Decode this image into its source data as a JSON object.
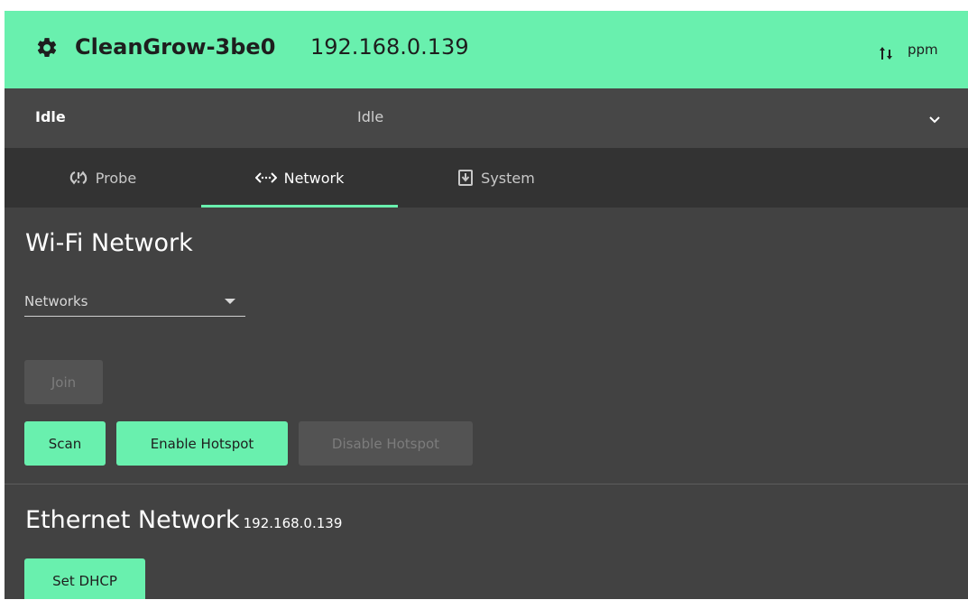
{
  "header": {
    "device_name": "CleanGrow-3be0",
    "ip": "192.168.0.139",
    "unit": "ppm",
    "icons": {
      "settings": "gear-icon",
      "sort": "sort-arrows-icon"
    }
  },
  "status": {
    "primary": "Idle",
    "secondary": "Idle",
    "icon": "chevron-down-icon"
  },
  "tabs": [
    {
      "label": "Probe",
      "icon": "probe-icon",
      "active": false
    },
    {
      "label": "Network",
      "icon": "network-icon",
      "active": true
    },
    {
      "label": "System",
      "icon": "system-icon",
      "active": false
    }
  ],
  "wifi": {
    "title": "Wi-Fi Network",
    "networks_placeholder": "Networks",
    "join_label": "Join",
    "scan_label": "Scan",
    "enable_hotspot_label": "Enable Hotspot",
    "disable_hotspot_label": "Disable Hotspot"
  },
  "ethernet": {
    "title": "Ethernet Network",
    "ip": "192.168.0.139",
    "dhcp_label": "Set DHCP"
  },
  "colors": {
    "accent": "#69f0ae",
    "background": "#424242",
    "tabbar": "#333333"
  }
}
